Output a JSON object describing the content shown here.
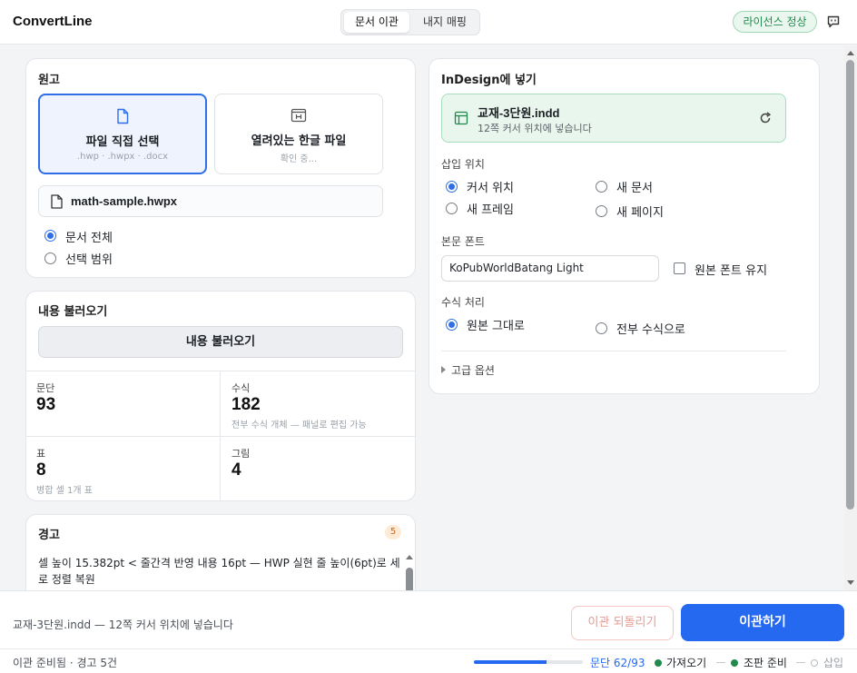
{
  "app": {
    "title": "ConvertLine"
  },
  "header": {
    "tabs": [
      {
        "label": "문서 이관",
        "active": true
      },
      {
        "label": "내지 매핑",
        "active": false
      }
    ],
    "license": "라이선스 정상",
    "feedback_icon": "feedback-icon"
  },
  "source": {
    "title": "원고",
    "options": [
      {
        "title": "파일 직접 선택",
        "sub": ".hwp · .hwpx · .docx",
        "icon": "file-icon",
        "selected": true
      },
      {
        "title": "열려있는 한글 파일",
        "sub": "확인 중...",
        "icon": "hwp-window-icon",
        "selected": false
      }
    ],
    "file_name": "math-sample.hwpx",
    "scope": [
      {
        "label": "문서 전체",
        "checked": true
      },
      {
        "label": "선택 범위",
        "checked": false
      }
    ]
  },
  "load": {
    "title": "내용 불러오기",
    "button": "내용 불러오기",
    "stats": [
      {
        "label": "문단",
        "value": "93",
        "note": ""
      },
      {
        "label": "수식",
        "value": "182",
        "note": "전부 수식 개체 — 패널로 편집 가능"
      },
      {
        "label": "표",
        "value": "8",
        "note": "병합 셀 1개 표"
      },
      {
        "label": "그림",
        "value": "4",
        "note": ""
      }
    ]
  },
  "warnings": {
    "title": "경고",
    "count": "5",
    "text": "셀 높이 15.382pt < 줄간격 반영 내용 16pt — HWP 실현 줄 높이(6pt)로 세로 정렬 복원"
  },
  "indesign": {
    "title": "InDesign에 넣기",
    "doc_name": "교재-3단원.indd",
    "doc_sub": "12쪽 커서 위치에 넣습니다",
    "refresh_icon": "refresh-icon",
    "insert_label": "삽입 위치",
    "insert_options": [
      {
        "label": "커서 위치",
        "checked": true
      },
      {
        "label": "새 문서",
        "checked": false
      },
      {
        "label": "새 프레임",
        "checked": false
      },
      {
        "label": "새 페이지",
        "checked": false
      }
    ],
    "font_label": "본문 폰트",
    "font_value": "KoPubWorldBatang Light",
    "keep_font_label": "원본 폰트 유지",
    "keep_font_checked": false,
    "math_label": "수식 처리",
    "math_options": [
      {
        "label": "원본 그대로",
        "checked": true
      },
      {
        "label": "전부 수식으로",
        "checked": false
      }
    ],
    "advanced": "고급 옵션"
  },
  "actions": {
    "message": "교재-3단원.indd — 12쪽 커서 위치에 넣습니다",
    "undo": "이관 되돌리기",
    "transfer": "이관하기"
  },
  "status": {
    "left": "이관 준비됨 · 경고 5건",
    "progress": 0.667,
    "paragraphs": "문단 62/93",
    "steps": [
      {
        "label": "가져오기",
        "done": true
      },
      {
        "label": "조판 준비",
        "done": true
      },
      {
        "label": "삽입",
        "done": false
      }
    ]
  },
  "colors": {
    "accent": "#2469ef",
    "success": "#1f8a4c",
    "warning": "#c4661d"
  }
}
